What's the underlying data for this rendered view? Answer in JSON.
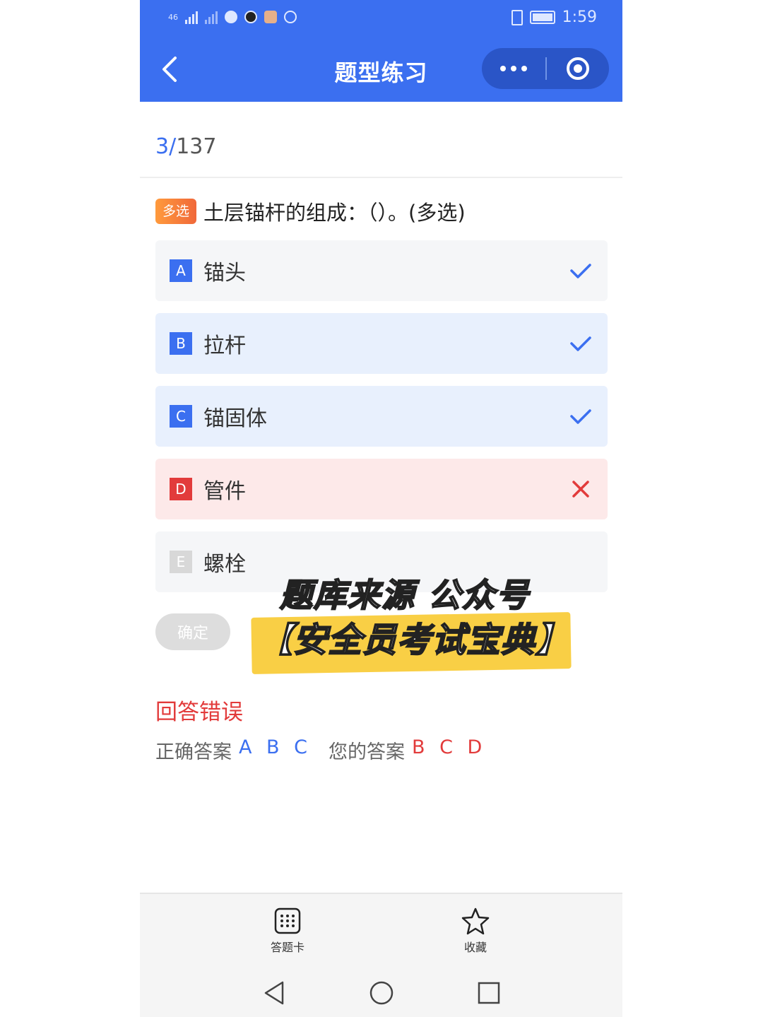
{
  "status": {
    "time": "1:59",
    "net": "46"
  },
  "nav": {
    "title": "题型练习"
  },
  "progress": {
    "current": "3",
    "separator": "/",
    "total": "137"
  },
  "question": {
    "tag": "多选",
    "text": "土层锚杆的组成：（）。(多选)"
  },
  "options": [
    {
      "letter": "A",
      "text": "锚头",
      "state": "selected-correct"
    },
    {
      "letter": "B",
      "text": "拉杆",
      "state": "selected-correct"
    },
    {
      "letter": "C",
      "text": "锚固体",
      "state": "selected-correct"
    },
    {
      "letter": "D",
      "text": "管件",
      "state": "wrong"
    },
    {
      "letter": "E",
      "text": "螺栓",
      "state": "unselected"
    }
  ],
  "confirm_label": "确定",
  "watermark": {
    "line1": "题库来源 公众号",
    "line2": "【安全员考试宝典】"
  },
  "result": {
    "title": "回答错误",
    "correct_label": "正确答案",
    "correct_value": "A B C",
    "yours_label": "您的答案",
    "yours_value": "B C D"
  },
  "tabbar": [
    {
      "label": "答题卡",
      "icon": "grid-card-icon"
    },
    {
      "label": "收藏",
      "icon": "star-icon"
    }
  ],
  "colors": {
    "primary": "#3b6ff0",
    "error": "#e23b3b",
    "tag": "#f0683a"
  }
}
